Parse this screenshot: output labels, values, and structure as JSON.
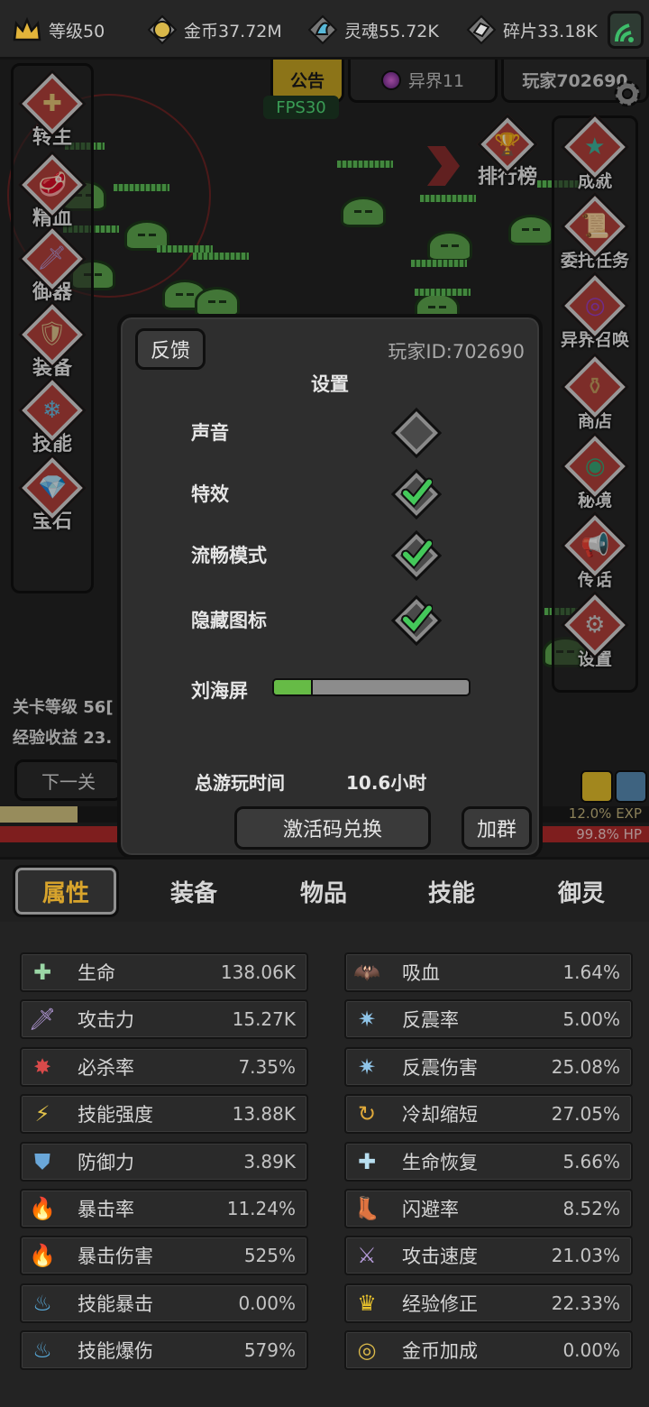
{
  "top_bar": {
    "level": "等级50",
    "gold": "金币37.72M",
    "soul": "灵魂55.72K",
    "fragment": "碎片33.18K"
  },
  "header_tabs": {
    "notice": "公告",
    "otherworld": "异界11",
    "player": "玩家702690",
    "fps": "FPS30"
  },
  "left_menu": [
    {
      "label": "转生",
      "icon": "ankh-icon"
    },
    {
      "label": "精血",
      "icon": "blood-meat-icon"
    },
    {
      "label": "御器",
      "icon": "sword-icon"
    },
    {
      "label": "装备",
      "icon": "armor-icon"
    },
    {
      "label": "技能",
      "icon": "crystal-icon"
    },
    {
      "label": "宝石",
      "icon": "gem-bag-icon"
    }
  ],
  "rank_label": "排行榜",
  "right_menu": [
    {
      "label": "成就",
      "icon": "star-icon"
    },
    {
      "label": "委托任务",
      "icon": "scroll-icon"
    },
    {
      "label": "异界召唤",
      "icon": "portal-icon"
    },
    {
      "label": "商店",
      "icon": "pot-icon"
    },
    {
      "label": "秘境",
      "icon": "green-portal-icon"
    },
    {
      "label": "传话",
      "icon": "horn-icon"
    },
    {
      "label": "设置",
      "icon": "gear-icon"
    }
  ],
  "stage": {
    "level_line": "关卡等级 56[",
    "exp_line": "经验收益 23.",
    "next_button": "下一关",
    "exp_bar_fraction": 0.12,
    "exp_text": "12.0% EXP",
    "hp_text": "99.8%  HP"
  },
  "settings_modal": {
    "feedback_button": "反馈",
    "player_id": "玩家ID:702690",
    "title": "设置",
    "options": [
      {
        "label": "声音",
        "checked": false
      },
      {
        "label": "特效",
        "checked": true
      },
      {
        "label": "流畅模式",
        "checked": true
      },
      {
        "label": "隐藏图标",
        "checked": true
      }
    ],
    "notch_label": "刘海屏",
    "notch_fraction": 0.2,
    "playtime_label": "总游玩时间",
    "playtime_value": "10.6小时",
    "redeem_button": "激活码兑换",
    "group_button": "加群"
  },
  "tabs": [
    {
      "label": "属性",
      "active": true
    },
    {
      "label": "装备",
      "active": false
    },
    {
      "label": "物品",
      "active": false
    },
    {
      "label": "技能",
      "active": false
    },
    {
      "label": "御灵",
      "active": false
    }
  ],
  "stats_left": [
    {
      "name": "生命",
      "value": "138.06K",
      "icon": "health-cross-icon"
    },
    {
      "name": "攻击力",
      "value": "15.27K",
      "icon": "sword-icon"
    },
    {
      "name": "必杀率",
      "value": "7.35%",
      "icon": "crit-burst-icon"
    },
    {
      "name": "技能强度",
      "value": "13.88K",
      "icon": "lightning-icon"
    },
    {
      "name": "防御力",
      "value": "3.89K",
      "icon": "shield-icon"
    },
    {
      "name": "暴击率",
      "value": "11.24%",
      "icon": "flame-icon"
    },
    {
      "name": "暴击伤害",
      "value": "525%",
      "icon": "flame-icon"
    },
    {
      "name": "技能暴击",
      "value": "0.00%",
      "icon": "blue-flame-icon"
    },
    {
      "name": "技能爆伤",
      "value": "579%",
      "icon": "blue-flame-icon"
    }
  ],
  "stats_right": [
    {
      "name": "吸血",
      "value": "1.64%",
      "icon": "bat-icon"
    },
    {
      "name": "反震率",
      "value": "5.00%",
      "icon": "shatter-icon"
    },
    {
      "name": "反震伤害",
      "value": "25.08%",
      "icon": "shatter-icon"
    },
    {
      "name": "冷却缩短",
      "value": "27.05%",
      "icon": "cooldown-icon"
    },
    {
      "name": "生命恢复",
      "value": "5.66%",
      "icon": "regen-icon"
    },
    {
      "name": "闪避率",
      "value": "8.52%",
      "icon": "boot-icon"
    },
    {
      "name": "攻击速度",
      "value": "21.03%",
      "icon": "attack-speed-icon"
    },
    {
      "name": "经验修正",
      "value": "22.33%",
      "icon": "crown-icon"
    },
    {
      "name": "金币加成",
      "value": "0.00%",
      "icon": "coin-icon"
    }
  ]
}
